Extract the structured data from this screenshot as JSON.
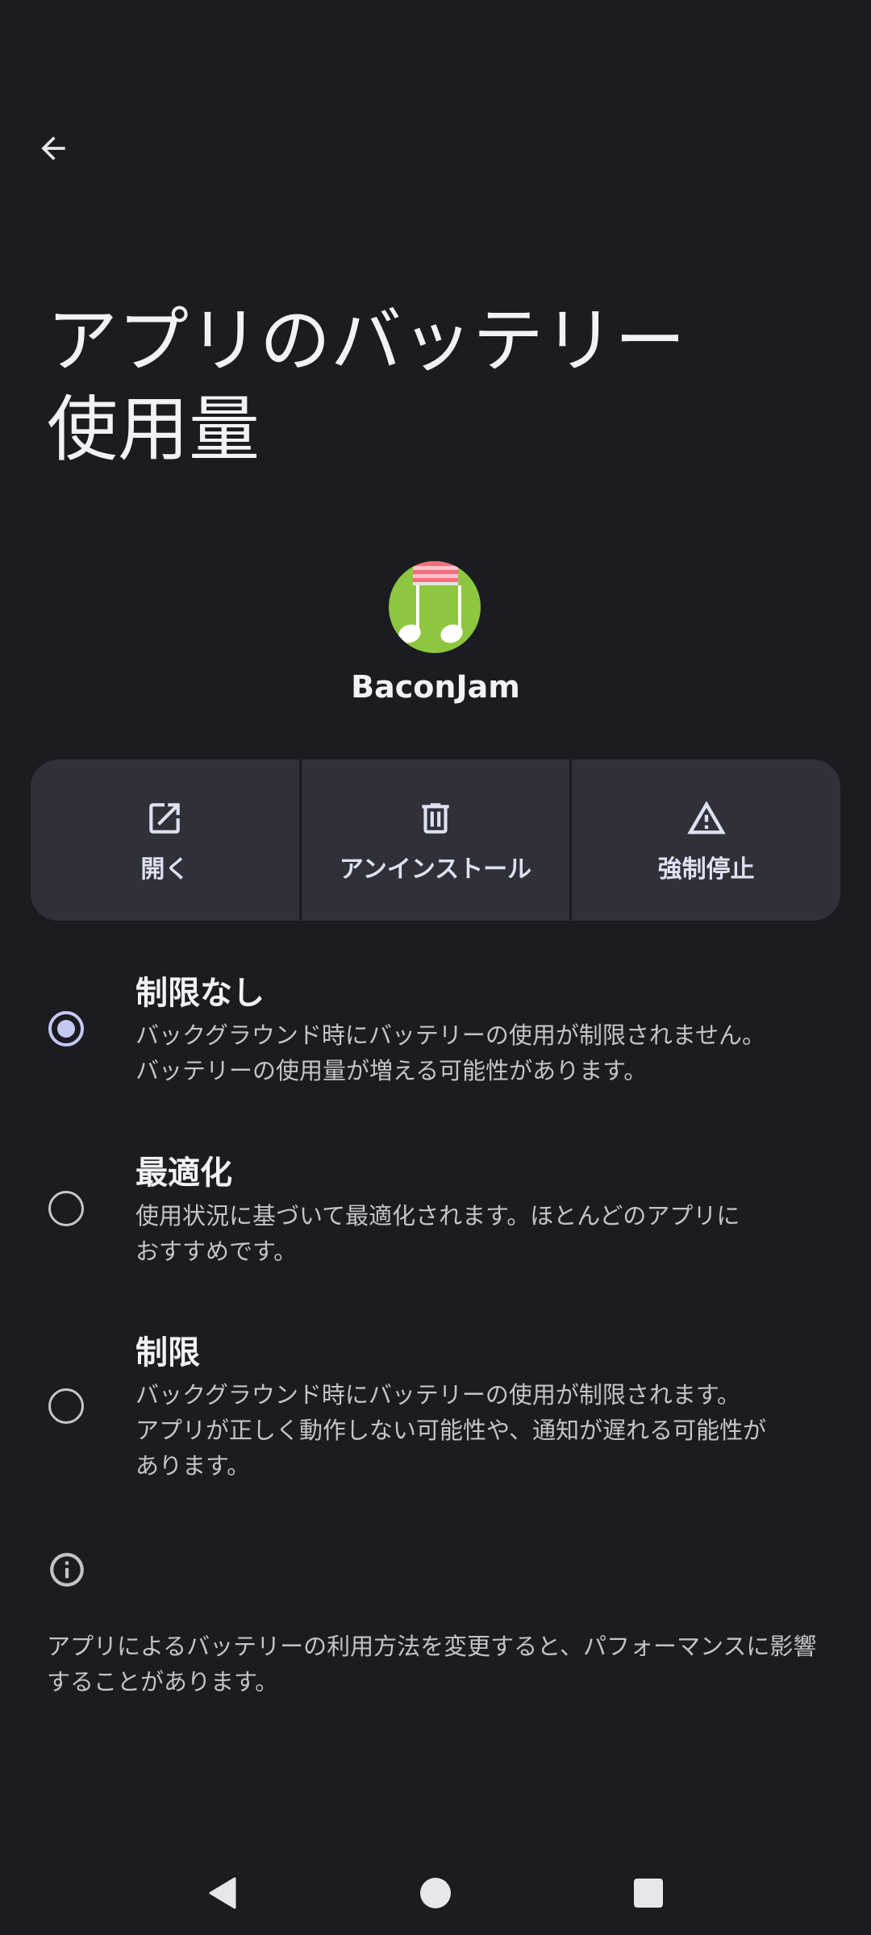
{
  "header": {
    "back_icon": "arrow-back-icon",
    "title": "アプリのバッテリー\n使用量"
  },
  "app": {
    "name": "BaconJam",
    "icon": "music-note-app-icon",
    "icon_bg_color": "#8dc63f"
  },
  "actions": [
    {
      "label": "開く",
      "icon": "open-external-icon"
    },
    {
      "label": "アンインストール",
      "icon": "trash-icon"
    },
    {
      "label": "強制停止",
      "icon": "warning-icon"
    }
  ],
  "options": [
    {
      "title": "制限なし",
      "description": "バックグラウンド時にバッテリーの使用が制限されません。\nバッテリーの使用量が増える可能性があります。",
      "selected": true
    },
    {
      "title": "最適化",
      "description": "使用状況に基づいて最適化されます。ほとんどのアプリに\nおすすめです。",
      "selected": false
    },
    {
      "title": "制限",
      "description": "バックグラウンド時にバッテリーの使用が制限されます。\nアプリが正しく動作しない可能性や、通知が遅れる可能性が\nあります。",
      "selected": false
    }
  ],
  "info": {
    "icon": "info-icon",
    "text": "アプリによるバッテリーの利用方法を変更すると、パフォーマンスに影響\nすることがあります。"
  },
  "nav": {
    "back_icon": "nav-back-icon",
    "home_icon": "nav-home-icon",
    "recents_icon": "nav-recents-icon"
  },
  "colors": {
    "background": "#1b1c21",
    "card": "#2f3038",
    "accent": "#c4c9f2"
  }
}
